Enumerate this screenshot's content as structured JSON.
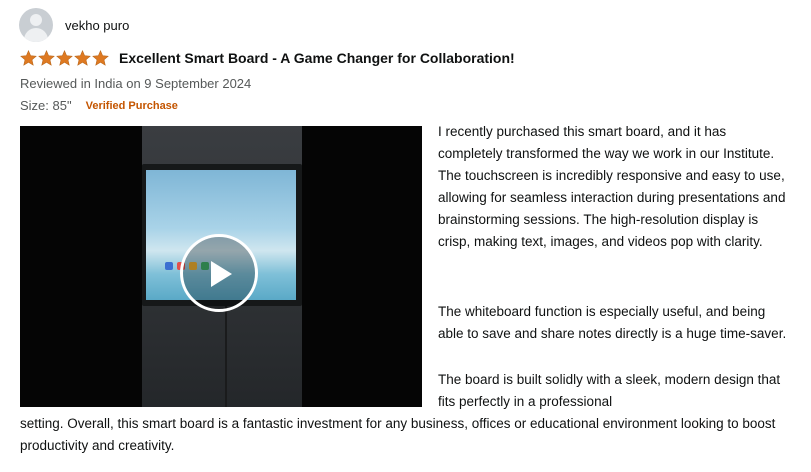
{
  "reviewer": {
    "name": "vekho puro",
    "avatar_icon": "default-user-avatar-icon"
  },
  "rating": {
    "stars": 5,
    "out_of": 5,
    "star_color": "#de7921"
  },
  "review": {
    "title": "Excellent Smart Board - A Game Changer for Collaboration!",
    "date_line": "Reviewed in India on 9 September 2024",
    "size_line": "Size: 85\"",
    "verified_label": "Verified Purchase",
    "verified_color": "#c45500",
    "body": {
      "paragraph_1": "I recently purchased this smart board, and it has completely transformed the way we work in our Institute. The touchscreen is incredibly responsive and easy to use, allowing for seamless interaction during presentations and brainstorming sessions. The high-resolution display is crisp, making text, images, and videos pop with clarity.",
      "paragraph_2": "The whiteboard function is especially useful, and being able to save and share notes directly is a huge time-saver.",
      "paragraph_3_part_1": "The board is built solidly with a sleek, modern design that fits perfectly in a professional",
      "paragraph_3_part_2": "setting. Overall, this smart board is a fantastic investment for any business, offices or educational environment looking to boost productivity and creativity."
    }
  },
  "video": {
    "play_icon": "play-icon"
  }
}
